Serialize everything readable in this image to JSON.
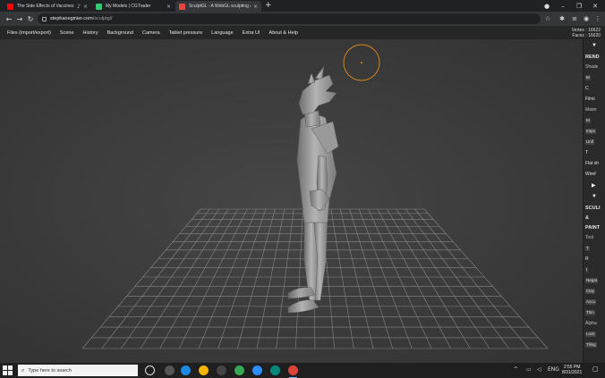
{
  "browser": {
    "tabs": [
      {
        "title": "The Side Effects of Vaccines",
        "favicon_color": "#ff0000",
        "active": false,
        "audio": true
      },
      {
        "title": "My Models | CGTrader",
        "favicon_color": "#2ecc71",
        "active": false,
        "audio": false
      },
      {
        "title": "SculptGL - A WebGL sculpting a",
        "favicon_color": "#e8453c",
        "active": true,
        "audio": false
      }
    ],
    "url_host": "stephaneginier.com",
    "url_path": "/sculptgl/"
  },
  "app": {
    "menu": [
      "Files (import/export)",
      "Scene",
      "History",
      "Background",
      "Camera",
      "Tablet pressure",
      "Language",
      "Extra UI",
      "About & Help"
    ],
    "vertices_text": "Vertex : 16622",
    "faces_text": "Faces : 16620",
    "brush_color": "#e08a1e"
  },
  "sidebar": {
    "rows": [
      {
        "type": "arrow",
        "text": "▼"
      },
      {
        "type": "head",
        "text": "REND"
      },
      {
        "type": "sub",
        "text": "Shade"
      },
      {
        "type": "ctrl",
        "text": "M"
      },
      {
        "type": "toggle",
        "text": "C"
      },
      {
        "type": "toggle",
        "text": "Filmi"
      },
      {
        "type": "sub",
        "text": "Mater"
      },
      {
        "type": "ctrl",
        "text": "M"
      },
      {
        "type": "ctrl",
        "text": "Impo"
      },
      {
        "type": "ctrl",
        "text": "Unif"
      },
      {
        "type": "toggle",
        "text": "T"
      },
      {
        "type": "toggle",
        "text": "Flat sh"
      },
      {
        "type": "toggle",
        "text": "Wiref"
      },
      {
        "type": "arrow",
        "text": "▶"
      },
      {
        "type": "arrow",
        "text": "▼"
      },
      {
        "type": "head",
        "text": "SCULI"
      },
      {
        "type": "head",
        "text": "&"
      },
      {
        "type": "head",
        "text": "PAINT"
      },
      {
        "type": "sub",
        "text": "Tool"
      },
      {
        "type": "ctrl",
        "text": "T"
      },
      {
        "type": "toggle",
        "text": "R"
      },
      {
        "type": "ctrl",
        "text": "I"
      },
      {
        "type": "ctrl",
        "text": "Negat"
      },
      {
        "type": "ctrl",
        "text": "Clay"
      },
      {
        "type": "ctrl",
        "text": "Accu"
      },
      {
        "type": "ctrl",
        "text": "Thin"
      },
      {
        "type": "sub",
        "text": "Alpha"
      },
      {
        "type": "ctrl",
        "text": "Lock"
      },
      {
        "type": "ctrl",
        "text": "Tiling"
      }
    ]
  },
  "taskbar": {
    "search_placeholder": "Type here to search",
    "apps": [
      {
        "name": "task-view",
        "color": "#555555"
      },
      {
        "name": "edge",
        "color": "#1e88e5"
      },
      {
        "name": "file-explorer",
        "color": "#f4b400"
      },
      {
        "name": "store",
        "color": "#444444"
      },
      {
        "name": "chrome",
        "color": "#34a853"
      },
      {
        "name": "zoom",
        "color": "#2d8cff"
      },
      {
        "name": "meet",
        "color": "#00897b"
      },
      {
        "name": "chrome-active",
        "color": "#db4437"
      }
    ],
    "time": "2:55 PM",
    "date": "8/31/2021"
  }
}
